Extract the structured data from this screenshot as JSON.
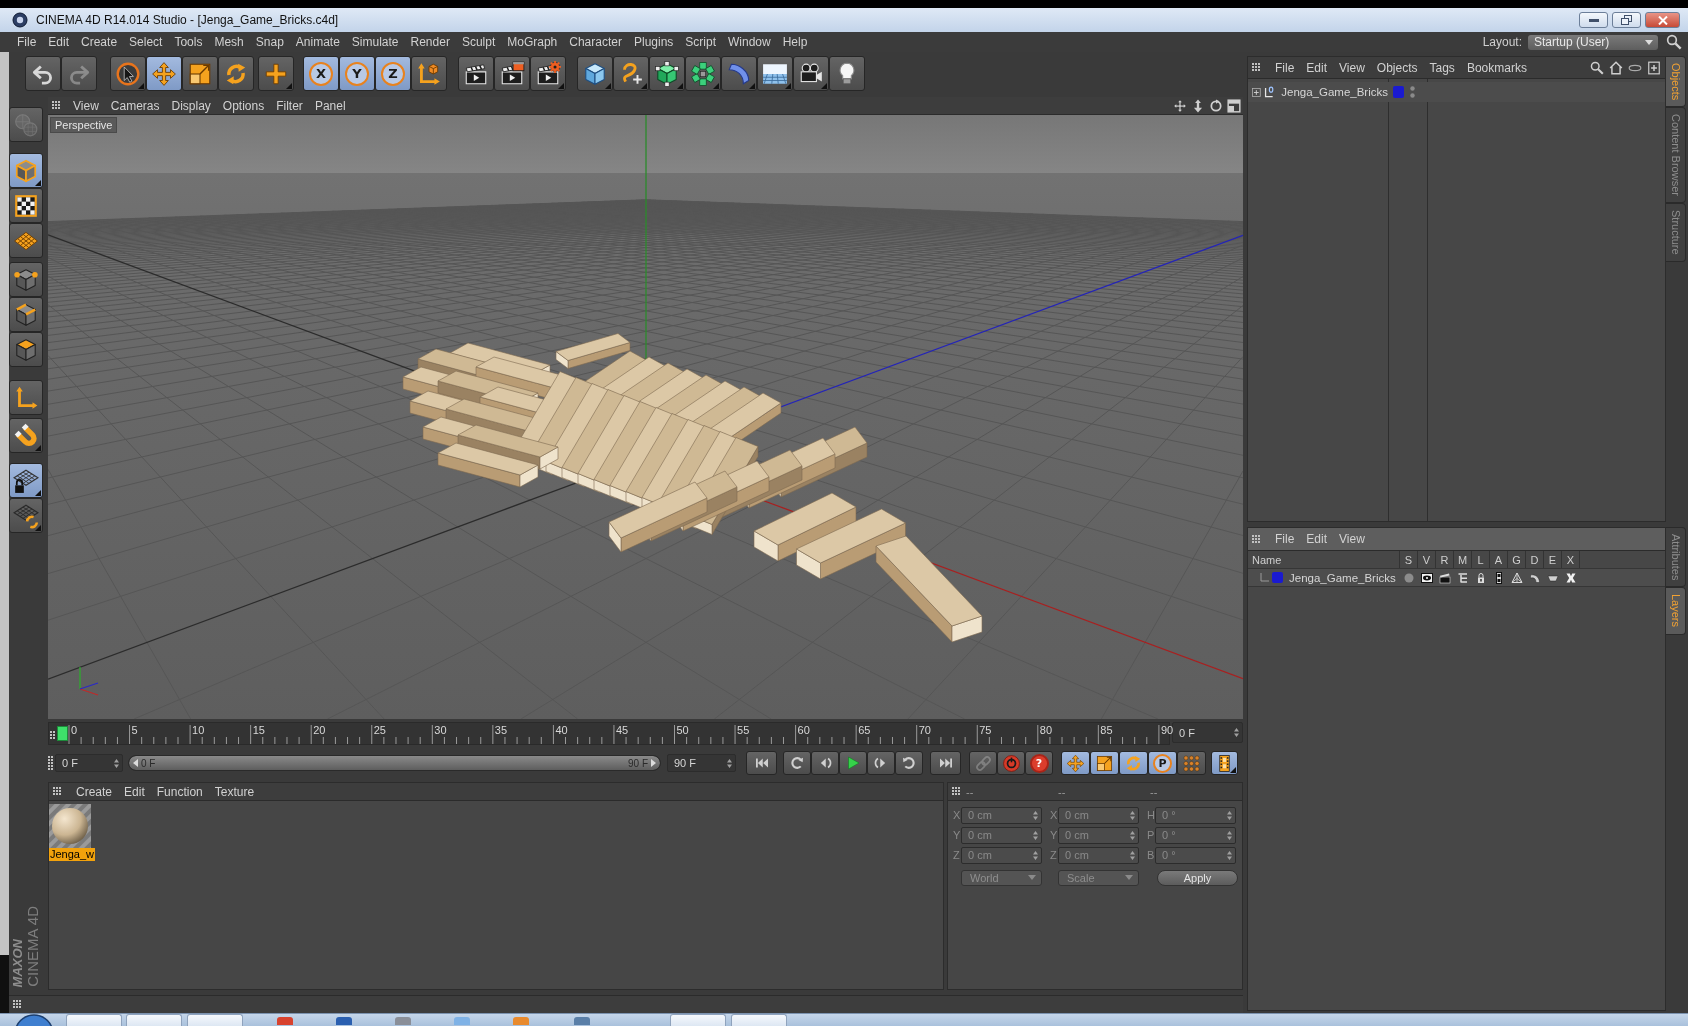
{
  "window": {
    "title": "CINEMA 4D R14.014 Studio - [Jenga_Game_Bricks.c4d]"
  },
  "menu_bar": [
    "File",
    "Edit",
    "Create",
    "Select",
    "Tools",
    "Mesh",
    "Snap",
    "Animate",
    "Simulate",
    "Render",
    "Sculpt",
    "MoGraph",
    "Character",
    "Plugins",
    "Script",
    "Window",
    "Help"
  ],
  "layout": {
    "label": "Layout:",
    "value": "Startup (User)"
  },
  "toolbar": [
    [
      {
        "kind": "undo",
        "disabled": false
      },
      {
        "kind": "redo",
        "disabled": true
      }
    ],
    [
      {
        "kind": "select",
        "selected": false
      },
      {
        "kind": "move",
        "selected": true
      },
      {
        "kind": "scale",
        "selected": false
      },
      {
        "kind": "rotate",
        "selected": false
      }
    ],
    [
      {
        "kind": "add",
        "selected": false
      }
    ],
    [
      {
        "kind": "axis",
        "label": "X",
        "selected": true
      },
      {
        "kind": "axis",
        "label": "Y",
        "selected": true
      },
      {
        "kind": "axis",
        "label": "Z",
        "selected": true
      },
      {
        "kind": "coords",
        "selected": false
      }
    ],
    [
      {
        "kind": "render-view"
      },
      {
        "kind": "render-picture"
      },
      {
        "kind": "render-settings"
      }
    ],
    [
      {
        "kind": "cube"
      },
      {
        "kind": "spline"
      },
      {
        "kind": "subdivision"
      },
      {
        "kind": "array"
      },
      {
        "kind": "deformer"
      },
      {
        "kind": "floor"
      },
      {
        "kind": "camera"
      },
      {
        "kind": "light"
      }
    ]
  ],
  "left_toolbar": [
    [
      {
        "kind": "make-editable",
        "disabled": true
      }
    ],
    [
      {
        "kind": "model",
        "selected": true
      },
      {
        "kind": "texture",
        "selected": false
      },
      {
        "kind": "workplane",
        "selected": false
      }
    ],
    [
      {
        "kind": "points",
        "selected": false
      },
      {
        "kind": "edges",
        "selected": false
      },
      {
        "kind": "polygons",
        "selected": false
      }
    ],
    [
      {
        "kind": "axis-mode",
        "selected": false
      }
    ],
    [
      {
        "kind": "snap",
        "selected": false
      }
    ],
    [
      {
        "kind": "workplane-lock",
        "selected": true
      },
      {
        "kind": "workplane-align",
        "selected": false
      }
    ]
  ],
  "logo": {
    "brand": "MAXON",
    "product": "CINEMA 4D"
  },
  "viewport": {
    "menu": [
      "View",
      "Cameras",
      "Display",
      "Options",
      "Filter",
      "Panel"
    ],
    "camera_label": "Perspective"
  },
  "timeline": {
    "ticks": [
      "0",
      "5",
      "10",
      "15",
      "20",
      "25",
      "30",
      "35",
      "40",
      "45",
      "50",
      "55",
      "60",
      "65",
      "70",
      "75",
      "80",
      "85",
      "90"
    ],
    "playhead": {
      "level": 0
    },
    "current_frame": "0 F",
    "start_frame": "0 F",
    "range": {
      "start": "0 F",
      "end": "90 F",
      "level": 1
    },
    "end_frame": "90 F"
  },
  "keying": [
    {
      "kind": "autokey",
      "disabled": true
    },
    {
      "kind": "record",
      "disabled": false
    },
    {
      "kind": "selection",
      "disabled": false,
      "symbol": "?"
    }
  ],
  "key_tracks": [
    {
      "kind": "position",
      "selected": true
    },
    {
      "kind": "scale",
      "selected": true
    },
    {
      "kind": "rotation",
      "selected": true
    },
    {
      "kind": "parameter",
      "label": "P",
      "selected": true
    },
    {
      "kind": "point",
      "selected": false
    }
  ],
  "timeline_button": {
    "selected": true
  },
  "material_manager": {
    "menu": [
      "Create",
      "Edit",
      "Function",
      "Texture"
    ],
    "materials": [
      {
        "name": "Jenga_w",
        "selected": true
      }
    ]
  },
  "coordinates": {
    "disabled": true,
    "headers": [
      "--",
      "--",
      "--"
    ],
    "rows": [
      [
        {
          "axis": "X",
          "value": "0 cm"
        },
        {
          "axis": "X",
          "value": "0 cm"
        },
        {
          "axis": "H",
          "value": "0 °"
        }
      ],
      [
        {
          "axis": "Y",
          "value": "0 cm"
        },
        {
          "axis": "Y",
          "value": "0 cm"
        },
        {
          "axis": "P",
          "value": "0 °"
        }
      ],
      [
        {
          "axis": "Z",
          "value": "0 cm"
        },
        {
          "axis": "Z",
          "value": "0 cm"
        },
        {
          "axis": "B",
          "value": "0 °"
        }
      ]
    ],
    "dropdowns": [
      "World",
      "Scale"
    ],
    "apply": "Apply"
  },
  "object_manager": {
    "menu": [
      "File",
      "Edit",
      "View",
      "Objects",
      "Tags",
      "Bookmarks"
    ],
    "objects": [
      {
        "name": "Jenga_Game_Bricks",
        "expanded": false,
        "selected": false,
        "color": "#1a1ad0"
      }
    ]
  },
  "layer_manager": {
    "menu": [
      "File",
      "Edit",
      "View"
    ],
    "columns": [
      "Name",
      "S",
      "V",
      "R",
      "M",
      "L",
      "A",
      "G",
      "D",
      "E",
      "X"
    ],
    "layers": [
      {
        "name": "Jenga_Game_Bricks",
        "color": "#1a1ad0",
        "toggles": [
          {
            "kind": "solo",
            "on": false
          },
          {
            "kind": "view",
            "on": true
          },
          {
            "kind": "render",
            "on": true
          },
          {
            "kind": "manager",
            "on": true
          },
          {
            "kind": "lock",
            "on": true
          },
          {
            "kind": "animation",
            "on": true
          },
          {
            "kind": "generators",
            "on": true
          },
          {
            "kind": "deformers",
            "on": true
          },
          {
            "kind": "expressions",
            "on": true
          },
          {
            "kind": "xrefs",
            "on": true
          }
        ]
      }
    ]
  },
  "side_tabs": {
    "top": [
      {
        "label": "Objects",
        "selected": true
      },
      {
        "label": "Content Browser",
        "selected": false
      },
      {
        "label": "Structure",
        "selected": false
      }
    ],
    "bottom": [
      {
        "label": "Attributes",
        "selected": false
      },
      {
        "label": "Layers",
        "selected": true
      }
    ]
  }
}
